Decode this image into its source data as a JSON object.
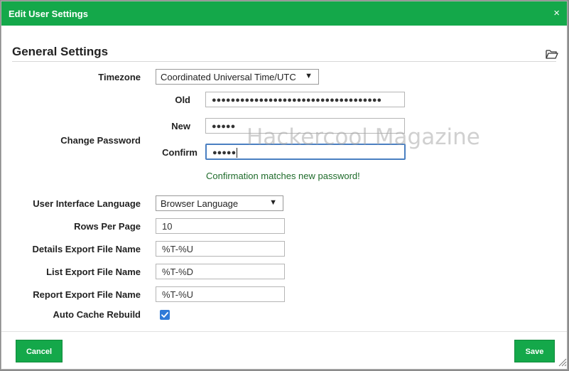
{
  "dialog": {
    "title": "Edit User Settings",
    "close_glyph": "×"
  },
  "section": {
    "title": "General Settings",
    "folder_icon": "folder-open-icon"
  },
  "timezone": {
    "label": "Timezone",
    "value": "Coordinated Universal Time/UTC",
    "arrow": "▼"
  },
  "password": {
    "label": "Change Password",
    "old_label": "Old",
    "old_value": "●●●●●●●●●●●●●●●●●●●●●●●●●●●●●●●●●●●●",
    "new_label": "New",
    "new_value": "●●●●●",
    "confirm_label": "Confirm",
    "confirm_value": "●●●●●",
    "message": "Confirmation matches new password!"
  },
  "language": {
    "label": "User Interface Language",
    "value": "Browser Language",
    "arrow": "▼"
  },
  "rows_per_page": {
    "label": "Rows Per Page",
    "value": "10"
  },
  "details_export": {
    "label": "Details Export File Name",
    "value": "%T-%U"
  },
  "list_export": {
    "label": "List Export File Name",
    "value": "%T-%D"
  },
  "report_export": {
    "label": "Report Export File Name",
    "value": "%T-%U"
  },
  "auto_cache": {
    "label": "Auto Cache Rebuild",
    "checked": true
  },
  "footer": {
    "cancel_label": "Cancel",
    "save_label": "Save"
  },
  "watermark": "Hackercool Magazine",
  "colors": {
    "accent": "#14a84a",
    "success_text": "#1e6b2a",
    "focus_border": "#4a7fc1",
    "checkbox": "#2f7ad8"
  }
}
